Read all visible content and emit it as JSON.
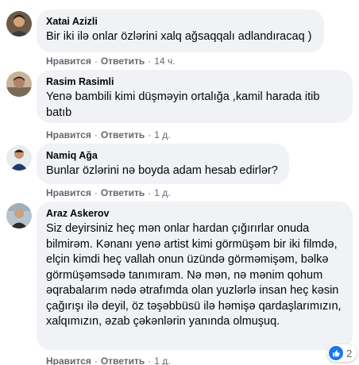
{
  "comments": [
    {
      "author": "Xatai Azizli",
      "text": "Bir iki ilə onlar özlərini xalq ağsaqqalı adlandıracaq )",
      "like_label": "Нравится",
      "reply_label": "Ответить",
      "time": "14 ч."
    },
    {
      "author": "Rasim Rasimli",
      "text": "Yenə bambili kimi düşməyin ortalığa ,kamil harada itib batıb",
      "like_label": "Нравится",
      "reply_label": "Ответить",
      "time": "1 д."
    },
    {
      "author": "Namiq Ağa",
      "text": "Bunlar özlərini nə boyda adam hesab edirlər?",
      "like_label": "Нравится",
      "reply_label": "Ответить",
      "time": "1 д."
    },
    {
      "author": "Araz Askerov",
      "text": "Siz deyirsiniz heç mən onlar hardan çığırırlar onuda bilmirəm. Kənanı yenə artist kimi görmüşəm bir iki filmdə, elçin kimdi heç vallah onun üzündə görməmişəm, bəlkə görmüşəmsədə tanımıram. Nə mən, nə mənim qohum əqrabalarım nədə ətrafımda olan yuzlərlə insan heç kəsin çağırışı ilə deyil, öz təşəbbüsü ilə həmişə qardaşlarımızın, xalqımızın, əzab çəkənlərin yanında olmuşuq.",
      "like_label": "Нравится",
      "reply_label": "Ответить",
      "time": "1 д.",
      "reaction": {
        "icon": "like-icon",
        "count": "2"
      }
    }
  ],
  "colors": {
    "bubble": "#f0f2f5",
    "meta": "#65676b",
    "like_blue": "#1877f2"
  }
}
